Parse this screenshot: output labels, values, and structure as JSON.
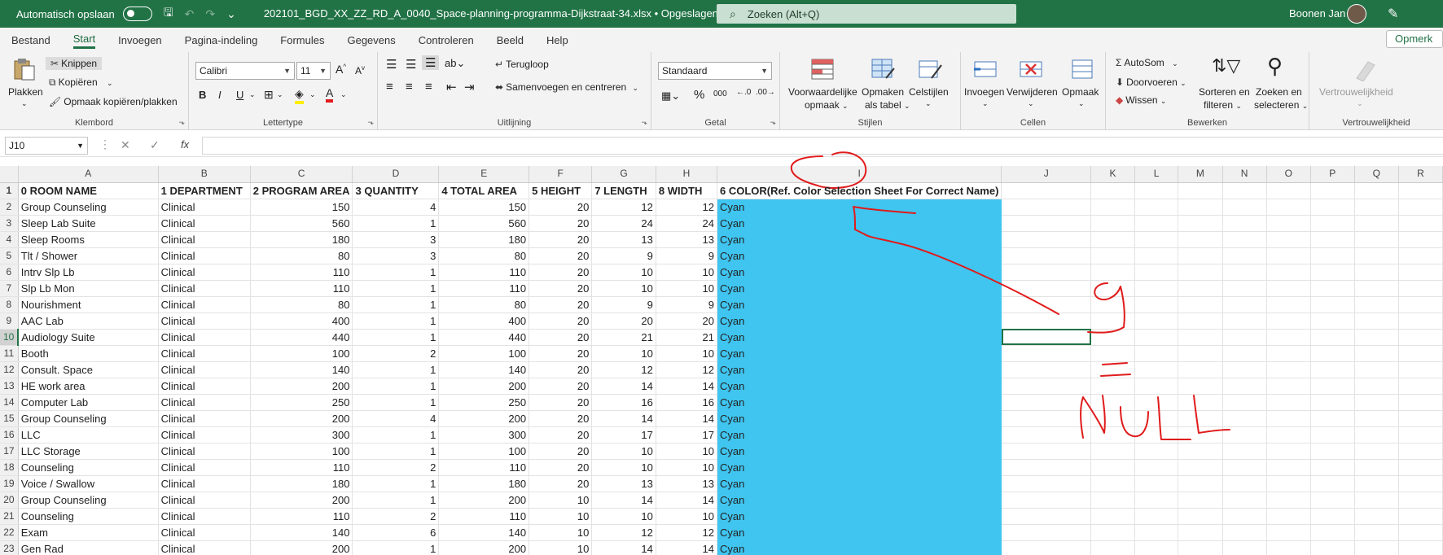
{
  "titlebar": {
    "autosave_label": "Automatisch opslaan",
    "filename": "202101_BGD_XX_ZZ_RD_A_0040_Space-planning-programma-Dijkstraat-34.xlsx • Opgeslagen ⌄",
    "search_placeholder": "Zoeken (Alt+Q)",
    "user": "Boonen Jan"
  },
  "tabs": [
    "Bestand",
    "Start",
    "Invoegen",
    "Pagina-indeling",
    "Formules",
    "Gegevens",
    "Controleren",
    "Beeld",
    "Help"
  ],
  "tab_right": "Opmerk",
  "ribbon": {
    "clipboard": {
      "label": "Klembord",
      "paste": "Plakken",
      "cut": "Knippen",
      "copy": "Kopiëren",
      "format_painter": "Opmaak kopiëren/plakken"
    },
    "font": {
      "label": "Lettertype",
      "font_name": "Calibri",
      "font_size": "11"
    },
    "alignment": {
      "label": "Uitlijning",
      "wrap": "Terugloop",
      "merge": "Samenvoegen en centreren"
    },
    "number": {
      "label": "Getal",
      "format": "Standaard"
    },
    "styles": {
      "label": "Stijlen",
      "conditional_1": "Voorwaardelijke",
      "conditional_2": "opmaak",
      "table_1": "Opmaken",
      "table_2": "als tabel",
      "cell_styles": "Celstijlen"
    },
    "cells": {
      "label": "Cellen",
      "insert": "Invoegen",
      "delete": "Verwijderen",
      "format": "Opmaak"
    },
    "editing": {
      "label": "Bewerken",
      "autosum": "AutoSom",
      "fill": "Doorvoeren",
      "clear": "Wissen",
      "sort_1": "Sorteren en",
      "sort_2": "filteren",
      "find_1": "Zoeken en",
      "find_2": "selecteren"
    },
    "sensitivity": {
      "label": "Vertrouwelijkheid",
      "button": "Vertrouwelijkheid"
    }
  },
  "formula_bar": {
    "namebox": "J10",
    "fx": "fx",
    "value": ""
  },
  "columns": [
    "A",
    "B",
    "C",
    "D",
    "E",
    "F",
    "G",
    "H",
    "I",
    "J",
    "K",
    "L",
    "M",
    "N",
    "O",
    "P",
    "Q",
    "R"
  ],
  "header_row": [
    "0 ROOM NAME",
    "1 DEPARTMENT",
    "2 PROGRAM AREA",
    "3 QUANTITY",
    "4 TOTAL AREA",
    "5 HEIGHT",
    "7 LENGTH",
    "8 WIDTH",
    "6 COLOR(Ref. Color Selection Sheet For Correct Name)"
  ],
  "rows": [
    [
      "Group Counseling",
      "Clinical",
      "150",
      "4",
      "150",
      "20",
      "12",
      "12",
      "Cyan"
    ],
    [
      "Sleep Lab Suite",
      "Clinical",
      "560",
      "1",
      "560",
      "20",
      "24",
      "24",
      "Cyan"
    ],
    [
      "Sleep Rooms",
      "Clinical",
      "180",
      "3",
      "180",
      "20",
      "13",
      "13",
      "Cyan"
    ],
    [
      "Tlt / Shower",
      "Clinical",
      "80",
      "3",
      "80",
      "20",
      "9",
      "9",
      "Cyan"
    ],
    [
      "Intrv Slp Lb",
      "Clinical",
      "110",
      "1",
      "110",
      "20",
      "10",
      "10",
      "Cyan"
    ],
    [
      "Slp Lb Mon",
      "Clinical",
      "110",
      "1",
      "110",
      "20",
      "10",
      "10",
      "Cyan"
    ],
    [
      "Nourishment",
      "Clinical",
      "80",
      "1",
      "80",
      "20",
      "9",
      "9",
      "Cyan"
    ],
    [
      "AAC Lab",
      "Clinical",
      "400",
      "1",
      "400",
      "20",
      "20",
      "20",
      "Cyan"
    ],
    [
      "Audiology Suite",
      "Clinical",
      "440",
      "1",
      "440",
      "20",
      "21",
      "21",
      "Cyan"
    ],
    [
      "Booth",
      "Clinical",
      "100",
      "2",
      "100",
      "20",
      "10",
      "10",
      "Cyan"
    ],
    [
      "Consult. Space",
      "Clinical",
      "140",
      "1",
      "140",
      "20",
      "12",
      "12",
      "Cyan"
    ],
    [
      "HE work area",
      "Clinical",
      "200",
      "1",
      "200",
      "20",
      "14",
      "14",
      "Cyan"
    ],
    [
      "Computer Lab",
      "Clinical",
      "250",
      "1",
      "250",
      "20",
      "16",
      "16",
      "Cyan"
    ],
    [
      "Group Counseling",
      "Clinical",
      "200",
      "4",
      "200",
      "20",
      "14",
      "14",
      "Cyan"
    ],
    [
      "LLC",
      "Clinical",
      "300",
      "1",
      "300",
      "20",
      "17",
      "17",
      "Cyan"
    ],
    [
      "LLC Storage",
      "Clinical",
      "100",
      "1",
      "100",
      "20",
      "10",
      "10",
      "Cyan"
    ],
    [
      "Counseling",
      "Clinical",
      "110",
      "2",
      "110",
      "20",
      "10",
      "10",
      "Cyan"
    ],
    [
      "Voice / Swallow",
      "Clinical",
      "180",
      "1",
      "180",
      "20",
      "13",
      "13",
      "Cyan"
    ],
    [
      "Group Counseling",
      "Clinical",
      "200",
      "1",
      "200",
      "10",
      "14",
      "14",
      "Cyan"
    ],
    [
      "Counseling",
      "Clinical",
      "110",
      "2",
      "110",
      "10",
      "10",
      "10",
      "Cyan"
    ],
    [
      "Exam",
      "Clinical",
      "140",
      "6",
      "140",
      "10",
      "12",
      "12",
      "Cyan"
    ],
    [
      "Gen Rad",
      "Clinical",
      "200",
      "1",
      "200",
      "10",
      "14",
      "14",
      "Cyan"
    ]
  ],
  "annotation": {
    "number": "9",
    "equals": "=",
    "word": "NULL"
  },
  "colors": {
    "excel_green": "#217346",
    "cyan_fill": "#3fc5f0",
    "ink_red": "#e01b1b"
  }
}
